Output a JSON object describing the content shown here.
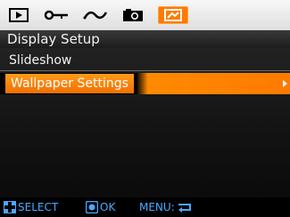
{
  "tabs": [
    {
      "icon": "playback-icon",
      "active": false
    },
    {
      "icon": "key-icon",
      "active": false
    },
    {
      "icon": "wave-icon",
      "active": false
    },
    {
      "icon": "camera-icon",
      "active": false
    },
    {
      "icon": "setup-icon",
      "active": true
    }
  ],
  "header": {
    "title": "Display Setup"
  },
  "menu": {
    "items": [
      {
        "label": "Slideshow",
        "selected": false
      },
      {
        "label": "Wallpaper Settings",
        "selected": true
      }
    ]
  },
  "hints": {
    "select": "SELECT",
    "ok": "OK",
    "menu": "MENU:"
  },
  "colors": {
    "accent": "#ff7a00",
    "hint": "#4aa8ff"
  }
}
